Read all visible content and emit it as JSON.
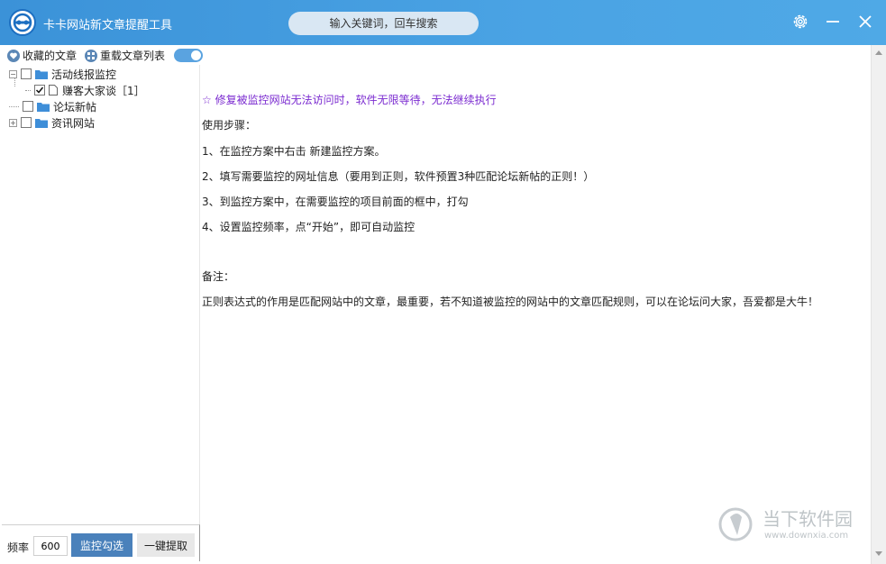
{
  "titlebar": {
    "title": "卡卡网站新文章提醒工具",
    "search_placeholder": "输入关键词，回车搜索",
    "icons": [
      "app-logo",
      "settings-gear-icon",
      "minimize-icon",
      "close-icon"
    ]
  },
  "toolbar": {
    "favorites_label": "收藏的文章",
    "reload_label": "重载文章列表",
    "reload_toggle_on": true
  },
  "tree": [
    {
      "label": "活动线报监控",
      "expanded": true,
      "checked": false
    },
    {
      "label": "赚客大家谈［1］",
      "checked": true,
      "type": "page"
    },
    {
      "label": "论坛新帖",
      "expanded": false,
      "checked": false
    },
    {
      "label": "资讯网站",
      "expanded": false,
      "checked": false
    }
  ],
  "content": {
    "notice": "☆ 修复被监控网站无法访问时，软件无限等待，无法继续执行",
    "steps_title": "使用步骤：",
    "steps": [
      "1、在监控方案中右击 新建监控方案。",
      "2、填写需要监控的网址信息（要用到正则，软件预置3种匹配论坛新帖的正则！）",
      "3、到监控方案中，在需要监控的项目前面的框中，打勾",
      "4、设置监控频率，点“开始”，即可自动监控"
    ],
    "note_title": "备注：",
    "note": "正则表达式的作用是匹配网站中的文章，最重要，若不知道被监控的网站中的文章匹配规则，可以在论坛问大家，吾爱都是大牛！"
  },
  "bottombar": {
    "freq_label": "频率",
    "freq_value": "600",
    "monitor_button": "监控勾选",
    "extract_button": "一键提取"
  },
  "watermark": {
    "text_cn": "当下软件园",
    "text_url": "www.downxia.com"
  },
  "colors": {
    "titlebar": "#4aa3e4",
    "primary_button": "#4a81bb",
    "notice_text": "#7b2bd0"
  }
}
